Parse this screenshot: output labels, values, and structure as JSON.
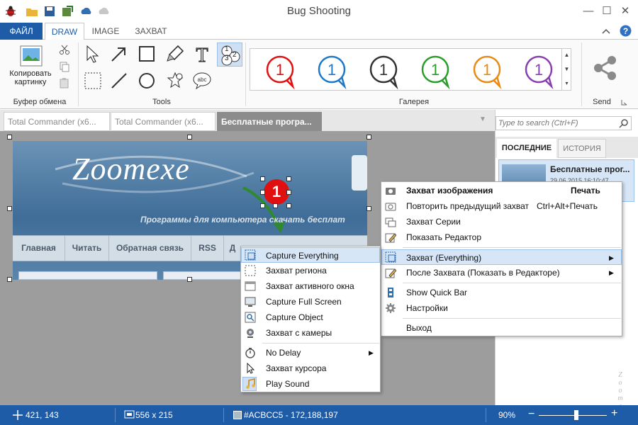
{
  "window": {
    "title": "Bug Shooting",
    "controls": {
      "minimize": "—",
      "maximize": "☐",
      "close": "✕"
    }
  },
  "ribbon_tabs": [
    {
      "label": "ФАЙЛ"
    },
    {
      "label": "DRAW"
    },
    {
      "label": "IMAGE"
    },
    {
      "label": "ЗАХВАТ"
    }
  ],
  "ribbon": {
    "clipboard": {
      "copy_label_line1": "Копировать",
      "copy_label_line2": "картинку",
      "group_label": "Буфер обмена"
    },
    "tools": {
      "group_label": "Tools",
      "counter_digits": [
        "1",
        "2",
        "3"
      ]
    },
    "gallery": {
      "group_label": "Галерея",
      "bubbles": [
        {
          "num": "1",
          "color": "#e01010"
        },
        {
          "num": "1",
          "color": "#1f79c9"
        },
        {
          "num": "1",
          "color": "#333333"
        },
        {
          "num": "1",
          "color": "#2a9d2a"
        },
        {
          "num": "1",
          "color": "#e88a16"
        },
        {
          "num": "1",
          "color": "#8a3fb0"
        }
      ]
    },
    "send": {
      "group_label": "Send"
    }
  },
  "doc_tabs": [
    {
      "label": "Total Commander (x6..."
    },
    {
      "label": "Total Commander (x6..."
    },
    {
      "label": "Бесплатные програ..."
    }
  ],
  "screenshot": {
    "logo": "Zoomexe",
    "tagline": "Программы для компьютера скачать бесплат",
    "nav": [
      "Главная",
      "Читать",
      "Обратная связь",
      "RSS",
      "Д"
    ],
    "marker_number": "1"
  },
  "search": {
    "placeholder": "Type to search (Ctrl+F)"
  },
  "history_panel": {
    "tabs": [
      "ПОСЛЕДНИЕ",
      "ИСТОРИЯ"
    ],
    "item": {
      "title": "Бесплатные прог...",
      "date": "29.06.2015 16:10:47"
    }
  },
  "context_menu": {
    "items": [
      {
        "label": "Захват изображения",
        "shortcut": "Печать",
        "bold": true
      },
      {
        "label": "Повторить предыдущий захват",
        "shortcut": "Ctrl+Alt+Печать"
      },
      {
        "label": "Захват Серии"
      },
      {
        "label": "Показать Редактор"
      },
      {
        "label": "Захват (Everything)",
        "submenu": true,
        "highlighted": true
      },
      {
        "label": "После Захвата (Показать в Редакторе)",
        "submenu": true
      },
      {
        "label": "Show Quick Bar"
      },
      {
        "label": "Настройки"
      },
      {
        "label": "Выход"
      }
    ]
  },
  "capture_submenu": {
    "items": [
      {
        "label": "Capture Everything"
      },
      {
        "label": "Захват региона"
      },
      {
        "label": "Захват активного окна"
      },
      {
        "label": "Capture Full Screen"
      },
      {
        "label": "Capture Object"
      },
      {
        "label": "Захват с камеры"
      },
      {
        "label": "No Delay",
        "submenu": true
      },
      {
        "label": "Захват курсора"
      },
      {
        "label": "Play Sound"
      }
    ]
  },
  "status": {
    "cursor": "421, 143",
    "size": "556 x 215",
    "color": "#ACBCC5 - 172,188,197",
    "swatch": "#ACBCC5",
    "zoom": "90%",
    "zoom_level": 0.55
  },
  "colors": {
    "accent": "#1e5ca8",
    "highlight": "#d6e6f7"
  }
}
